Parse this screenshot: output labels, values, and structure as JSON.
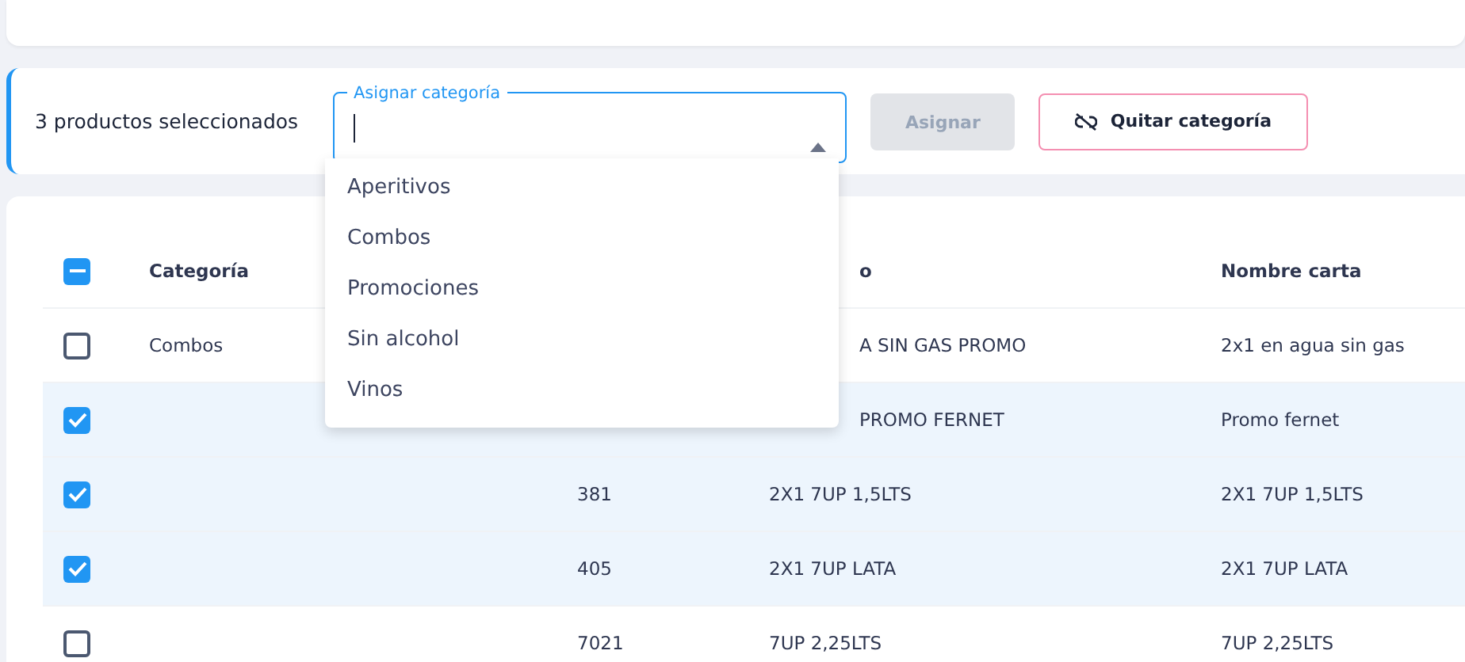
{
  "selection_bar": {
    "count_label": "3 productos seleccionados",
    "category_field": {
      "label": "Asignar categoría",
      "open": true,
      "options": [
        {
          "label": "Aperitivos"
        },
        {
          "label": "Combos"
        },
        {
          "label": "Promociones"
        },
        {
          "label": "Sin alcohol"
        },
        {
          "label": "Vinos"
        }
      ]
    },
    "assign_button": {
      "label": "Asignar",
      "disabled": true
    },
    "remove_button": {
      "label": "Quitar categoría"
    }
  },
  "table": {
    "select_all": {
      "checked": true,
      "indeterminate": true
    },
    "columns": [
      "Categoría",
      null,
      "o",
      "Nombre carta"
    ],
    "rows": [
      {
        "selected": false,
        "cells": [
          "Combos",
          null,
          "A SIN GAS PROMO",
          "2x1 en agua sin gas"
        ]
      },
      {
        "selected": true,
        "cells": [
          null,
          null,
          "PROMO FERNET",
          "Promo fernet"
        ]
      },
      {
        "selected": true,
        "cells": [
          null,
          "381",
          "2X1 7UP 1,5LTS",
          "2X1 7UP 1,5LTS"
        ]
      },
      {
        "selected": true,
        "cells": [
          null,
          "405",
          "2X1 7UP LATA",
          "2X1 7UP LATA"
        ]
      },
      {
        "selected": false,
        "cells": [
          null,
          "7021",
          "7UP 2,25LTS",
          "7UP 2,25LTS"
        ]
      }
    ]
  }
}
